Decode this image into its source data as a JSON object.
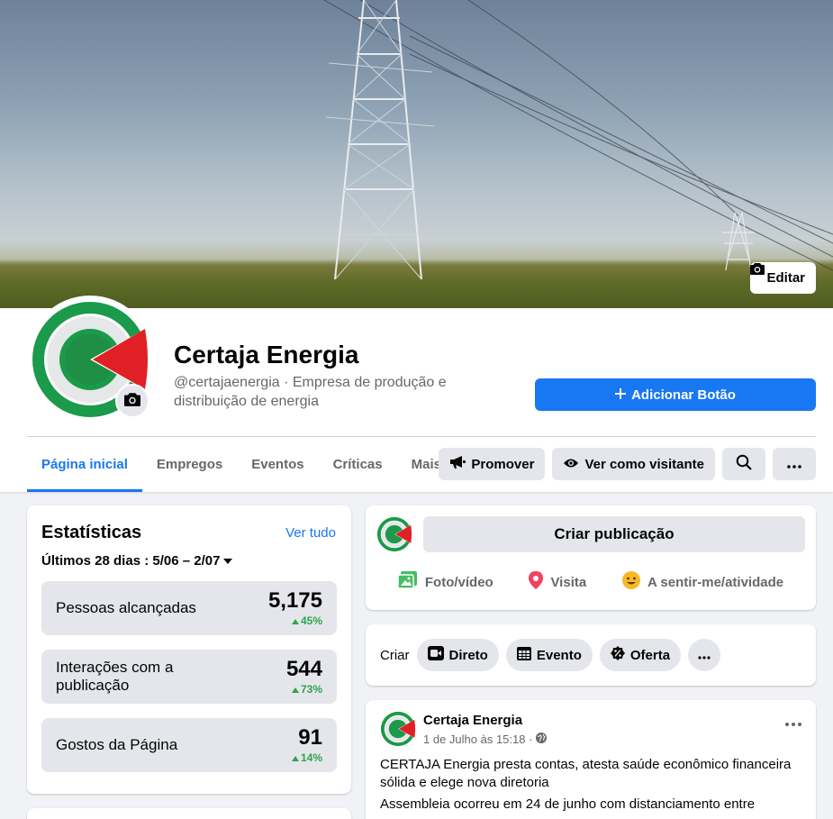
{
  "cover": {
    "edit_label": "Editar"
  },
  "page": {
    "name": "Certaja Energia",
    "handle_line": "@certajaenergia · Empresa de produção e distribuição de energia",
    "add_button": "Adicionar Botão"
  },
  "nav": {
    "tabs": [
      {
        "label": "Página inicial",
        "active": true
      },
      {
        "label": "Empregos"
      },
      {
        "label": "Eventos"
      },
      {
        "label": "Críticas"
      },
      {
        "label": "Mais"
      }
    ],
    "actions": {
      "promote": "Promover",
      "view_as": "Ver como visitante"
    }
  },
  "stats": {
    "title": "Estatísticas",
    "see_all": "Ver tudo",
    "range": "Últimos 28 dias : 5/06 – 2/07",
    "items": [
      {
        "label": "Pessoas alcançadas",
        "value": "5,175",
        "delta": "45%"
      },
      {
        "label": "Interações com a publicação",
        "value": "544",
        "delta": "73%"
      },
      {
        "label": "Gostos da Página",
        "value": "91",
        "delta": "14%"
      }
    ]
  },
  "composer": {
    "placeholder": "Criar publicação",
    "options": [
      {
        "label": "Foto/vídeo",
        "icon": "photo-icon"
      },
      {
        "label": "Visita",
        "icon": "location-pin-icon"
      },
      {
        "label": "A sentir-me/atividade",
        "icon": "smiley-icon"
      }
    ]
  },
  "create": {
    "label": "Criar",
    "items": [
      {
        "label": "Direto",
        "icon": "live-video-icon"
      },
      {
        "label": "Evento",
        "icon": "calendar-icon"
      },
      {
        "label": "Oferta",
        "icon": "percent-tag-icon"
      }
    ]
  },
  "post": {
    "author": "Certaja Energia",
    "time": "1 de Julho às 15:18 ·",
    "text": "CERTAJA Energia presta contas, atesta saúde econômico financeira sólida e elege nova diretoria",
    "text2": "Assembleia ocorreu em 24 de junho com distanciamento entre"
  },
  "colors": {
    "accent": "#1877f2",
    "positive": "#31a24c",
    "logo_green": "#1a9a4a",
    "logo_red": "#e02024"
  }
}
